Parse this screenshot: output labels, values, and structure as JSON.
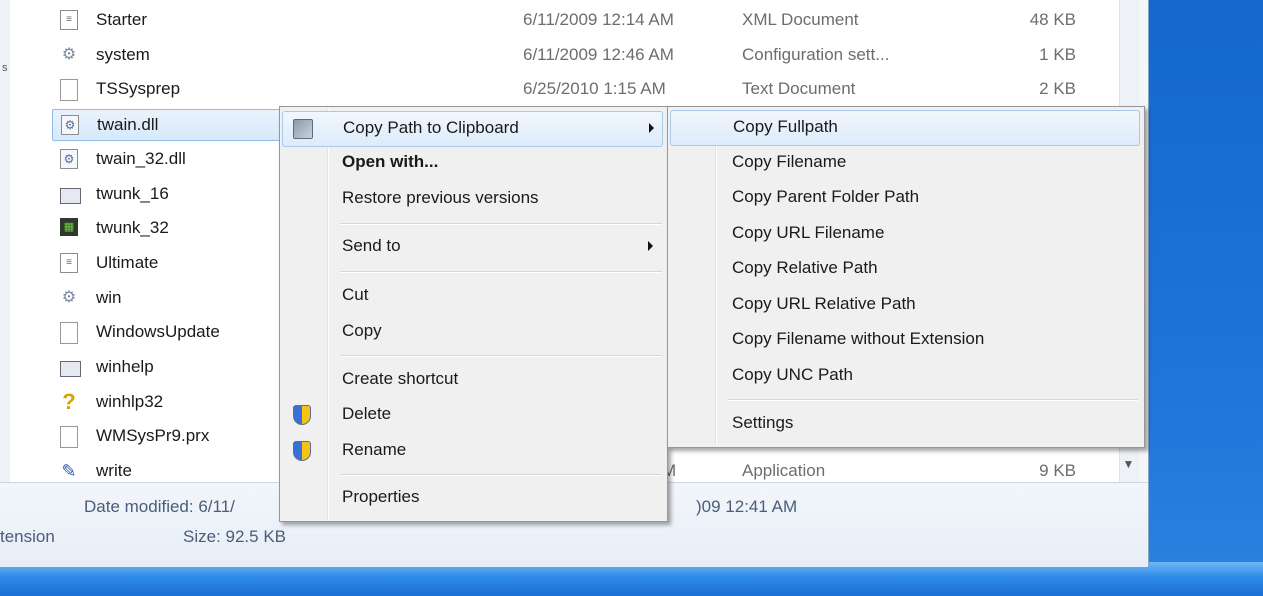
{
  "files": [
    {
      "name": "Starter",
      "date": "6/11/2009 12:14 AM",
      "type": "XML Document",
      "size": "48 KB",
      "icon": "xml-file-icon"
    },
    {
      "name": "system",
      "date": "6/11/2009 12:46 AM",
      "type": "Configuration sett...",
      "size": "1 KB",
      "icon": "settings-file-icon"
    },
    {
      "name": "TSSysprep",
      "date": "6/25/2010 1:15 AM",
      "type": "Text Document",
      "size": "2 KB",
      "icon": "text-file-icon"
    },
    {
      "name": "twain.dll",
      "date": "",
      "type": "",
      "size": "",
      "icon": "dll-file-icon"
    },
    {
      "name": "twain_32.dll",
      "date": "",
      "type": "",
      "size": "",
      "icon": "dll-file-icon"
    },
    {
      "name": "twunk_16",
      "date": "",
      "type": "",
      "size": "",
      "icon": "app-window-icon"
    },
    {
      "name": "twunk_32",
      "date": "",
      "type": "",
      "size": "",
      "icon": "scanner-app-icon"
    },
    {
      "name": "Ultimate",
      "date": "",
      "type": "",
      "size": "",
      "icon": "xml-file-icon"
    },
    {
      "name": "win",
      "date": "",
      "type": "",
      "size": "",
      "icon": "settings-file-icon"
    },
    {
      "name": "WindowsUpdate",
      "date": "",
      "type": "",
      "size": "",
      "icon": "text-file-icon"
    },
    {
      "name": "winhelp",
      "date": "",
      "type": "",
      "size": "",
      "icon": "app-window-icon"
    },
    {
      "name": "winhlp32",
      "date": "",
      "type": "",
      "size": "",
      "icon": "help-icon"
    },
    {
      "name": "WMSysPr9.prx",
      "date": "",
      "type": "",
      "size": "",
      "icon": "text-file-icon"
    },
    {
      "name": "write",
      "date": "M",
      "type": "Application",
      "size": "9 KB",
      "icon": "wordpad-icon"
    }
  ],
  "selected_file": "twain.dll",
  "details": {
    "date_modified": "Date modified: 6/11/",
    "date_created_tail": ")09 12:41 AM",
    "size": "Size: 92.5 KB",
    "type_tail": "tension"
  },
  "context_menu": {
    "copy_path": "Copy Path to Clipboard",
    "open_with": "Open with...",
    "restore": "Restore previous versions",
    "send_to": "Send to",
    "cut": "Cut",
    "copy": "Copy",
    "create_shortcut": "Create shortcut",
    "delete": "Delete",
    "rename": "Rename",
    "properties": "Properties"
  },
  "submenu": {
    "copy_fullpath": "Copy Fullpath",
    "copy_filename": "Copy Filename",
    "copy_parent": "Copy Parent Folder Path",
    "copy_url_filename": "Copy URL Filename",
    "copy_relative": "Copy Relative Path",
    "copy_url_relative": "Copy URL Relative Path",
    "copy_no_ext": "Copy Filename without Extension",
    "copy_unc": "Copy UNC Path",
    "settings": "Settings"
  },
  "left_marks": [
    "s"
  ],
  "colors": {
    "desktop": "#1e74d8",
    "highlight_border": "#a8c8ec",
    "selected_row": "#d7e9fb"
  }
}
